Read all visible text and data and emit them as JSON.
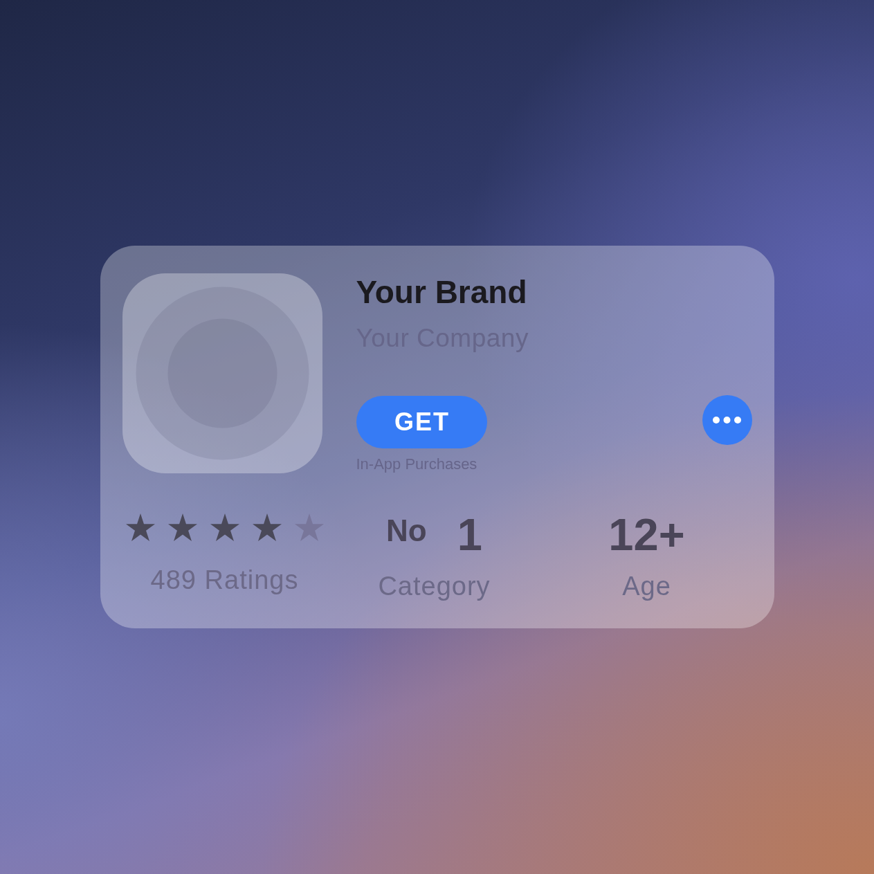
{
  "app": {
    "name": "Your Brand",
    "developer": "Your Company"
  },
  "actions": {
    "get_button": "GET",
    "purchases_note": "In-App Purchases"
  },
  "stats": [
    {
      "kind": "rating",
      "stars": 4,
      "caption": "489 Ratings"
    },
    {
      "kind": "rank",
      "prefix": "No",
      "value": "1",
      "caption": "Category"
    },
    {
      "kind": "value",
      "value": "12+",
      "caption": "Age"
    }
  ]
}
